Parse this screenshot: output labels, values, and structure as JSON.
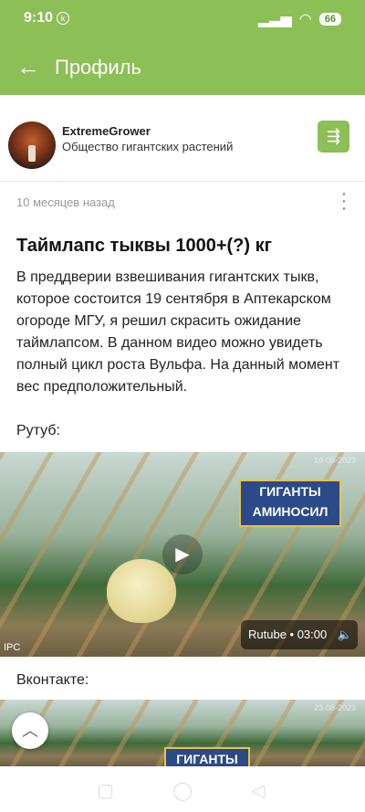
{
  "status": {
    "time": "9:10",
    "k_icon": "k-icon",
    "battery": "66"
  },
  "appbar": {
    "title": "Профиль"
  },
  "profile": {
    "username": "ExtremeGrower",
    "group": "Общество гигантских растений"
  },
  "post": {
    "time_ago": "10 месяцев назад",
    "title": "Таймлапс тыквы 1000+(?) кг",
    "body": "В преддверии взвешивания гигантских тыкв, которое состоится 19 сентября в Аптекарском огороде МГУ, я решил скрасить ожидание таймлапсом. В данном видео можно увидеть полный цикл роста Вульфа. На данный момент вес предположительный.",
    "rutube_label": "Рутуб:",
    "vk_label": "Вконтакте:"
  },
  "video1": {
    "banner_line1": "ГИГАНТЫ",
    "banner_line2": "АМИНОСИЛ",
    "info": "Rutube • 03:00",
    "watermark": "IPC",
    "stamp": "18-08-2023"
  },
  "video2": {
    "banner_line1": "ГИГАНТЫ",
    "stamp": "23-08-2023"
  }
}
